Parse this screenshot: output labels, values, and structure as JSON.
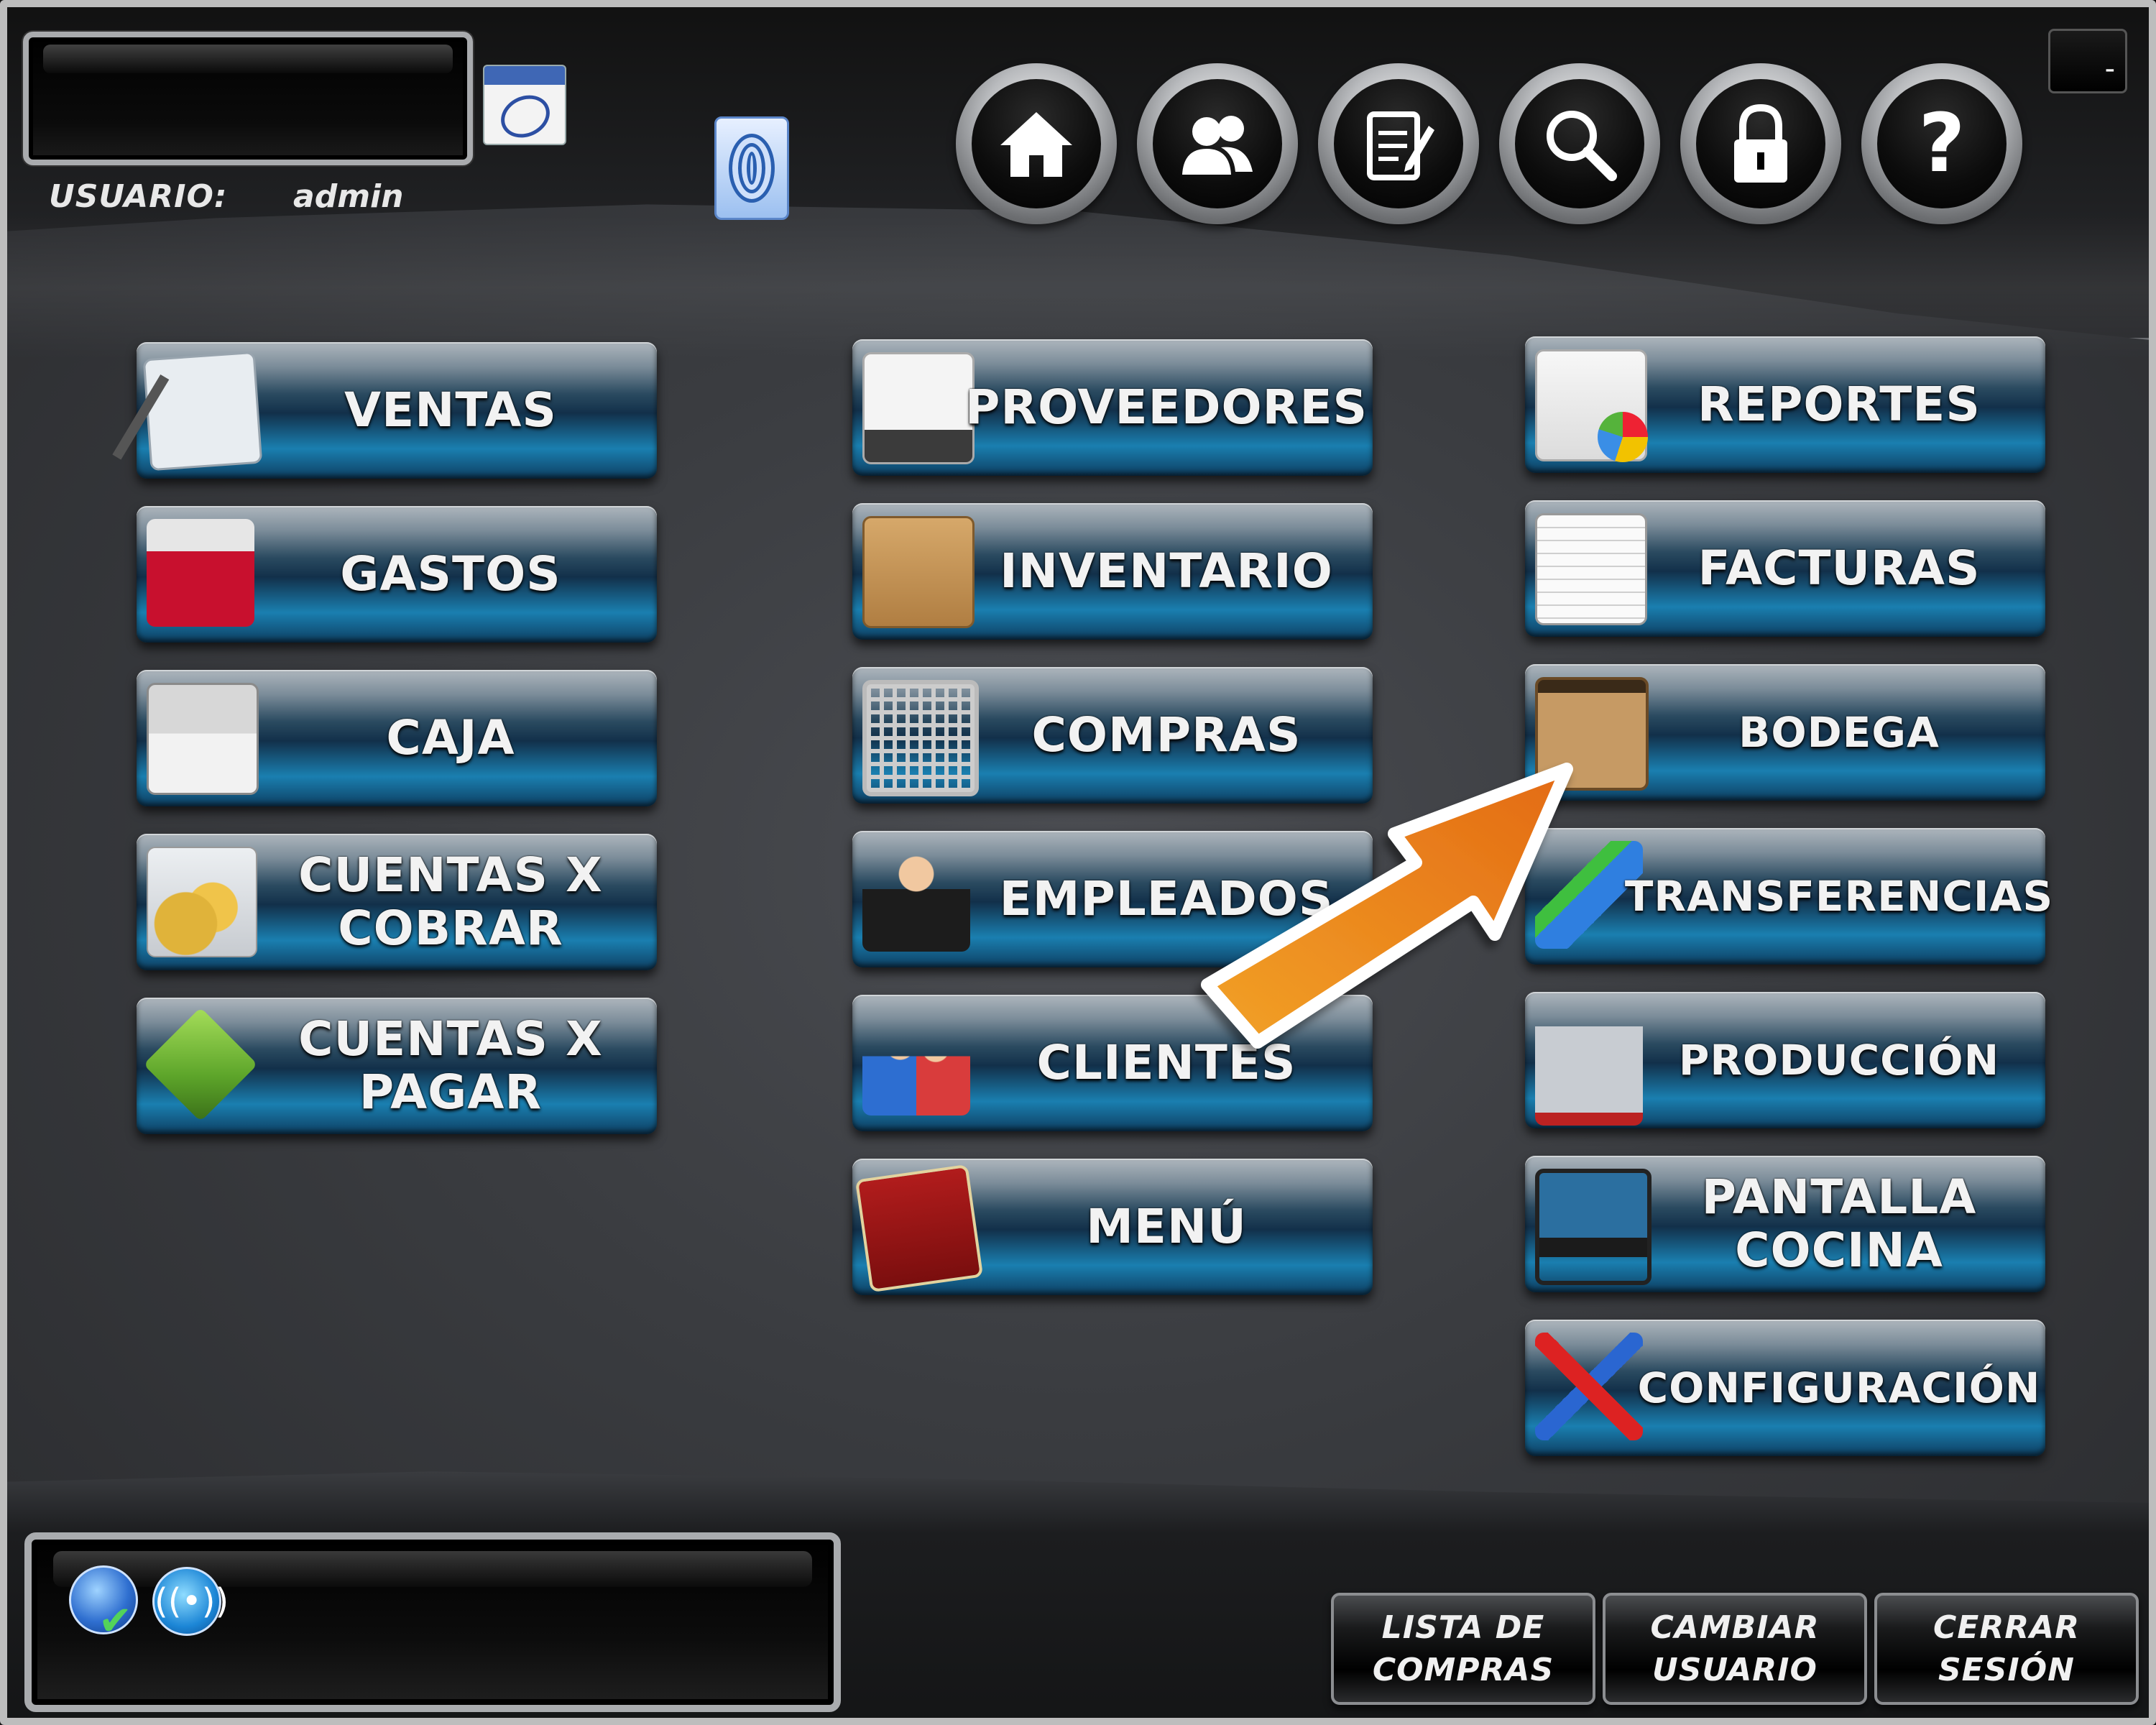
{
  "header": {
    "user_label": "USUARIO:",
    "user_name": "admin",
    "display_text": "",
    "minimize_label": "-"
  },
  "icons": {
    "calendar": "calendar-icon",
    "fingerprint": "fingerprint-icon",
    "network_status": "globe-check-icon",
    "signal": "wireless-signal-icon"
  },
  "nav": [
    {
      "name": "home-icon",
      "glyph": "⌂"
    },
    {
      "name": "users-icon",
      "glyph": "👥"
    },
    {
      "name": "notepad-edit-icon",
      "glyph": "✎"
    },
    {
      "name": "search-icon",
      "glyph": "⚲"
    },
    {
      "name": "lock-icon",
      "glyph": "🔒"
    },
    {
      "name": "help-icon",
      "glyph": "?"
    }
  ],
  "modules": {
    "col1": [
      {
        "label": "VENTAS",
        "icon": "notepad-pen-icon"
      },
      {
        "label": "GASTOS",
        "icon": "red-folder-icon"
      },
      {
        "label": "CAJA",
        "icon": "cash-register-icon"
      },
      {
        "label": "CUENTAS X\nCOBRAR",
        "icon": "coins-notes-icon"
      },
      {
        "label": "CUENTAS X\nPAGAR",
        "icon": "green-book-icon"
      }
    ],
    "col2": [
      {
        "label": "PROVEEDORES",
        "icon": "delivery-truck-icon"
      },
      {
        "label": "INVENTARIO",
        "icon": "open-box-icon"
      },
      {
        "label": "COMPRAS",
        "icon": "shopping-cart-icon"
      },
      {
        "label": "EMPLEADOS",
        "icon": "waiter-icon"
      },
      {
        "label": "CLIENTES",
        "icon": "people-icon"
      },
      {
        "label": "MENÚ",
        "icon": "red-menu-book-icon"
      }
    ],
    "col3": [
      {
        "label": "REPORTES",
        "icon": "report-chart-icon"
      },
      {
        "label": "FACTURAS",
        "icon": "invoice-icon"
      },
      {
        "label": "BODEGA",
        "icon": "stacked-crates-icon"
      },
      {
        "label": "TRANSFERENCIAS",
        "icon": "transfer-arrows-icon"
      },
      {
        "label": "PRODUCCIÓN",
        "icon": "factory-icon"
      },
      {
        "label": "PANTALLA\nCOCINA",
        "icon": "kitchen-monitor-icon"
      },
      {
        "label": "CONFIGURACIÓN",
        "icon": "tools-icon"
      }
    ]
  },
  "footer": {
    "status_text": "",
    "buttons": [
      "LISTA DE\nCOMPRAS",
      "CAMBIAR\nUSUARIO",
      "CERRAR\nSESIÓN"
    ]
  },
  "colors": {
    "arrow": "#e8841e",
    "arrow_outline": "#ffffff",
    "button_blue": "#1a7fb0",
    "background": "#3a3c40"
  }
}
